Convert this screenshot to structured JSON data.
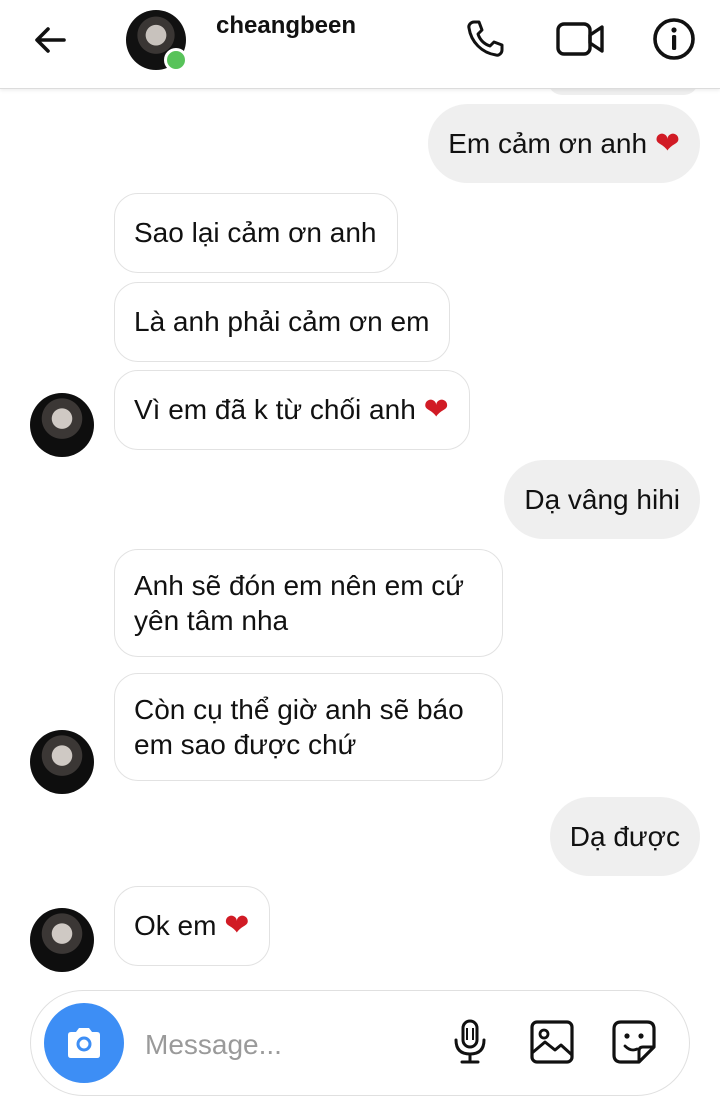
{
  "header": {
    "username": "cheangbeen",
    "online": true,
    "icons": [
      "back-arrow-icon",
      "phone-icon",
      "video-camera-icon",
      "info-icon"
    ]
  },
  "messages": [
    {
      "side": "out",
      "text": "Em cảm ơn anh",
      "heart": true
    },
    {
      "side": "in",
      "text": "Sao lại cảm ơn anh",
      "heart": false
    },
    {
      "side": "in",
      "text": "Là anh phải cảm ơn em",
      "heart": false
    },
    {
      "side": "in",
      "text": "Vì em đã k từ chối anh",
      "heart": true
    },
    {
      "side": "out",
      "text": "Dạ vâng hihi",
      "heart": false
    },
    {
      "side": "in",
      "text": "Anh sẽ đón em nên em cứ yên tâm nha",
      "heart": false
    },
    {
      "side": "in",
      "text": "Còn cụ thể giờ anh sẽ báo em sao được chứ",
      "heart": false
    },
    {
      "side": "out",
      "text": "Dạ được",
      "heart": false
    },
    {
      "side": "in",
      "text": "Ok em",
      "heart": true
    }
  ],
  "heart_glyph": "❤",
  "heart_color": "#d11b25",
  "composer": {
    "placeholder": "Message...",
    "value": "",
    "icons": [
      "camera-icon",
      "microphone-icon",
      "gallery-icon",
      "sticker-icon"
    ],
    "camera_button_color": "#3d8ef5"
  },
  "colors": {
    "outgoing_bubble": "#efefef",
    "incoming_bubble_border": "#e2e2e2",
    "online_indicator": "#58c35a"
  }
}
